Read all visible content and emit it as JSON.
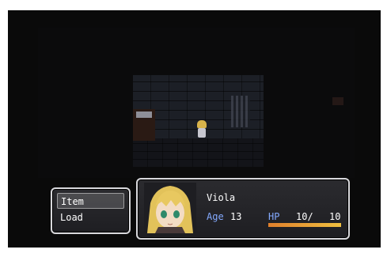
{
  "menu": {
    "items": [
      {
        "label": "Item",
        "selected": true
      },
      {
        "label": "Load",
        "selected": false
      }
    ]
  },
  "actor": {
    "name": "Viola",
    "age_label": "Age",
    "age": "13",
    "hp_label": "HP",
    "hp_current": "10/",
    "hp_max": "10",
    "hp_fraction": 1.0
  },
  "colors": {
    "system_label": "#84aaff",
    "hp_gauge_start": "#e0802c",
    "hp_gauge_end": "#f0c040"
  }
}
